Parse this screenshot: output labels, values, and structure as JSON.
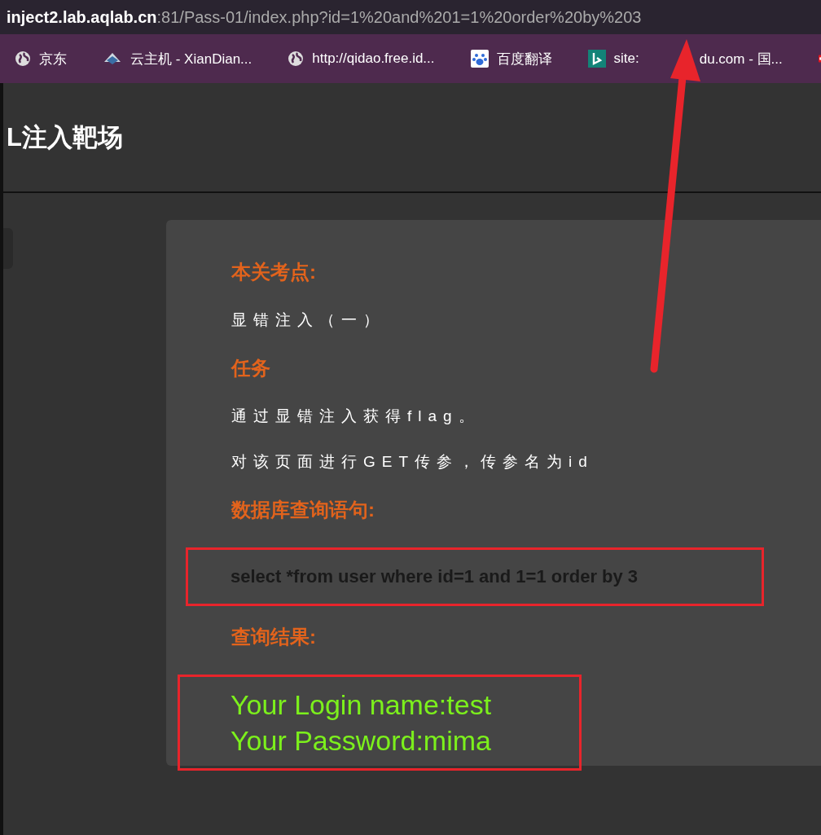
{
  "address_bar": {
    "domain": "inject2.lab.aqlab.cn",
    "rest": ":81/Pass-01/index.php?id=1%20and%201=1%20order%20by%203"
  },
  "bookmarks": [
    {
      "label": "京东"
    },
    {
      "label": "云主机 - XianDian..."
    },
    {
      "label": "http://qidao.free.id..."
    },
    {
      "label": "百度翻译"
    },
    {
      "label": "site:",
      "label_after": "du.com - 国..."
    }
  ],
  "page_title": "L注入靶场",
  "sections": [
    {
      "kind": "heading",
      "text": "本关考点:"
    },
    {
      "kind": "text",
      "text": "显错注入（一）"
    },
    {
      "kind": "heading",
      "text": "任务"
    },
    {
      "kind": "text",
      "text": "通过显错注入获得flag。"
    },
    {
      "kind": "text",
      "text": "对该页面进行GET传参，传参名为id"
    },
    {
      "kind": "heading",
      "text": "数据库查询语句:"
    },
    {
      "kind": "query",
      "text": "select *from user where id=1 and 1=1 order by 3"
    },
    {
      "kind": "heading",
      "text": "查询结果:"
    },
    {
      "kind": "result",
      "lines": [
        "Your Login name:test",
        "Your Password:mima"
      ]
    }
  ]
}
